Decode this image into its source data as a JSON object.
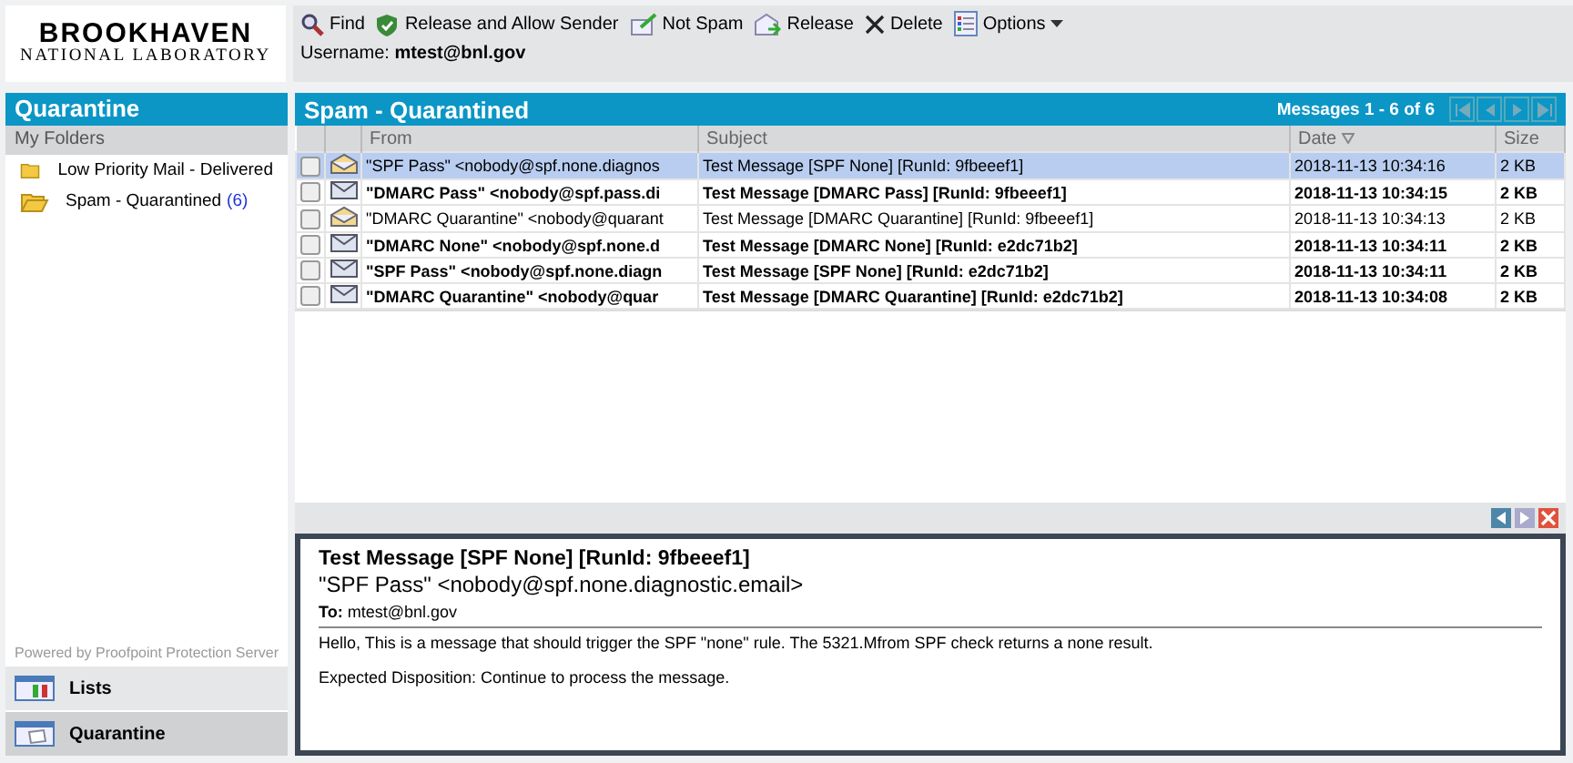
{
  "logo": {
    "line1": "BROOKHAVEN",
    "line2": "NATIONAL LABORATORY"
  },
  "toolbar": [
    {
      "label": "Find",
      "kind": "find"
    },
    {
      "label": "Release and Allow Sender",
      "kind": "shield"
    },
    {
      "label": "Not Spam",
      "kind": "notspam"
    },
    {
      "label": "Release",
      "kind": "release"
    },
    {
      "label": "Delete",
      "kind": "delete"
    },
    {
      "label": "Options",
      "kind": "options"
    }
  ],
  "username": {
    "label": "Username:",
    "value": "mtest@bnl.gov"
  },
  "sidebar": {
    "title": "Quarantine",
    "section": "My Folders",
    "items": [
      {
        "label": "Low Priority Mail - Delivered",
        "selected": false
      },
      {
        "label": "Spam - Quarantined",
        "count": "(6)",
        "selected": true
      }
    ],
    "powered_by": "Powered by Proofpoint Protection Server",
    "nav": [
      {
        "label": "Lists",
        "kind": "lists",
        "selected": false
      },
      {
        "label": "Quarantine",
        "kind": "quarantine",
        "selected": true
      }
    ]
  },
  "list": {
    "title": "Spam - Quarantined",
    "range": "Messages 1 - 6 of 6",
    "columns": [
      "From",
      "Subject",
      "Date",
      "Size"
    ],
    "rows": [
      {
        "from": "\"SPF Pass\" <nobody@spf.none.diagnos",
        "subject": "Test Message [SPF None] [RunId: 9fbeeef1]",
        "date": "2018-11-13 10:34:16",
        "size": "2 KB",
        "read": true,
        "selected": true,
        "checked": false
      },
      {
        "from": "\"DMARC Pass\" <nobody@spf.pass.di",
        "subject": "Test Message [DMARC Pass] [RunId: 9fbeeef1]",
        "date": "2018-11-13 10:34:15",
        "size": "2 KB",
        "read": false,
        "selected": false,
        "checked": false
      },
      {
        "from": "\"DMARC Quarantine\" <nobody@quarant",
        "subject": "Test Message [DMARC Quarantine] [RunId: 9fbeeef1]",
        "date": "2018-11-13 10:34:13",
        "size": "2 KB",
        "read": true,
        "selected": false,
        "checked": false
      },
      {
        "from": "\"DMARC None\" <nobody@spf.none.d",
        "subject": "Test Message [DMARC None] [RunId: e2dc71b2]",
        "date": "2018-11-13 10:34:11",
        "size": "2 KB",
        "read": false,
        "selected": false,
        "checked": false
      },
      {
        "from": "\"SPF Pass\" <nobody@spf.none.diagn",
        "subject": "Test Message [SPF None] [RunId: e2dc71b2]",
        "date": "2018-11-13 10:34:11",
        "size": "2 KB",
        "read": false,
        "selected": false,
        "checked": false
      },
      {
        "from": "\"DMARC Quarantine\" <nobody@quar",
        "subject": "Test Message [DMARC Quarantine] [RunId: e2dc71b2]",
        "date": "2018-11-13 10:34:08",
        "size": "2 KB",
        "read": false,
        "selected": false,
        "checked": false
      }
    ]
  },
  "preview": {
    "subject": "Test Message [SPF None] [RunId: 9fbeeef1]",
    "from": "\"SPF Pass\" <nobody@spf.none.diagnostic.email>",
    "to_label": "To:",
    "to": "mtest@bnl.gov",
    "body": [
      "Hello, This is a message that should trigger the SPF \"none\" rule. The 5321.Mfrom SPF check returns a none result.",
      "Expected Disposition: Continue to process the message."
    ]
  }
}
